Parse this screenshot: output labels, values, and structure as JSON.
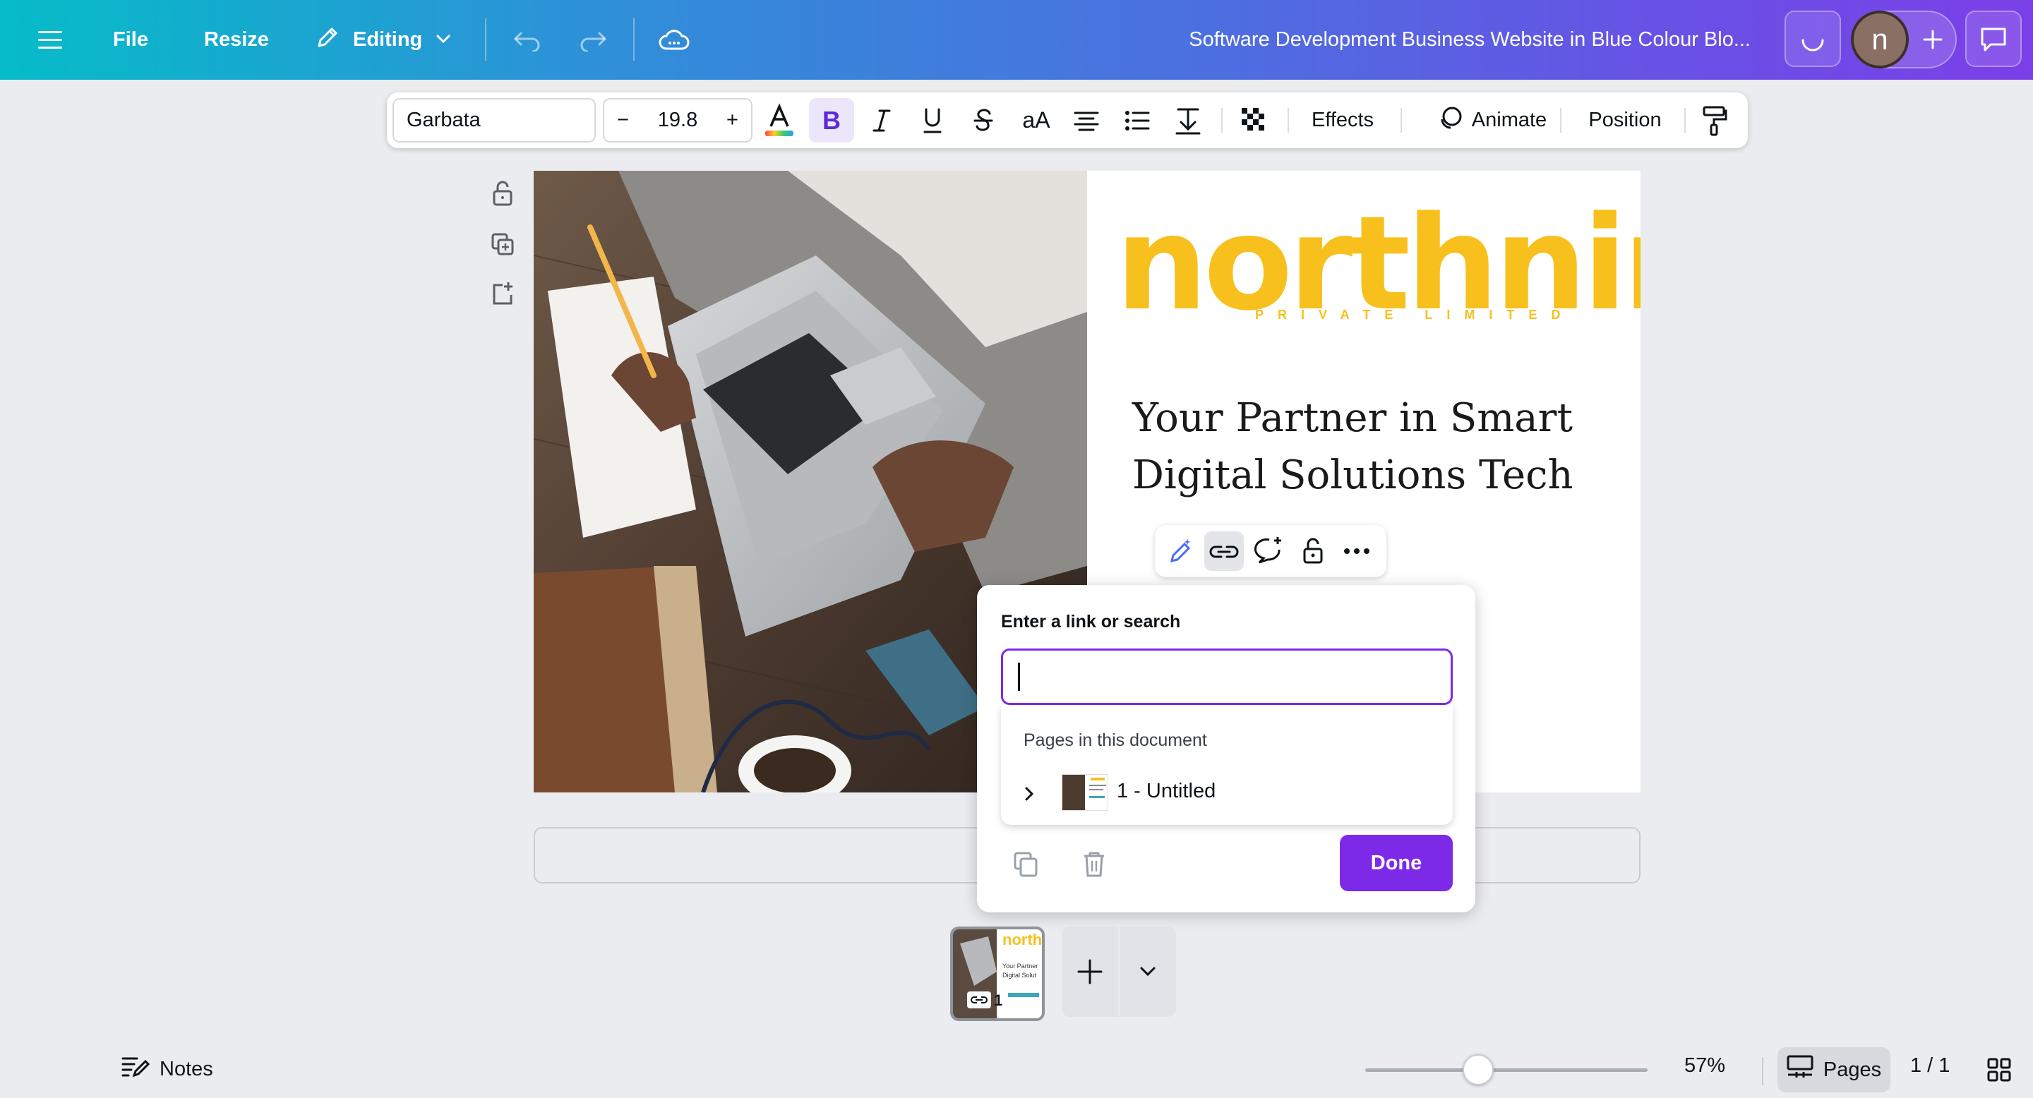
{
  "topbar": {
    "file_label": "File",
    "resize_label": "Resize",
    "mode_label": "Editing",
    "document_title": "Software Development Business Website in Blue Colour Blo...",
    "avatar_initial": "n"
  },
  "text_toolbar": {
    "font_name": "Garbata",
    "font_size": "19.8",
    "minus_label": "−",
    "plus_label": "+",
    "case_label": "aA",
    "effects_label": "Effects",
    "animate_label": "Animate",
    "position_label": "Position"
  },
  "canvas": {
    "logo_main": "northnine",
    "logo_sub": "PRIVATE LIMITED",
    "headline_line1": "Your Partner in Smart",
    "headline_line2": "Digital Solutions Tech"
  },
  "link_popup": {
    "label": "Enter a link or search",
    "input_value": "",
    "dropdown_title": "Pages in this document",
    "page_item": "1 - Untitled",
    "done_label": "Done"
  },
  "thumbnail": {
    "page_number": "1",
    "logo": "north",
    "text": "Your Partner Digital Solut"
  },
  "bottombar": {
    "notes_label": "Notes",
    "zoom_value": "57%",
    "zoom_fraction": 0.4,
    "pages_label": "Pages",
    "page_count": "1 / 1"
  },
  "colors": {
    "brand_purple": "#7d2ae8",
    "logo_yellow": "#f7c01d"
  }
}
